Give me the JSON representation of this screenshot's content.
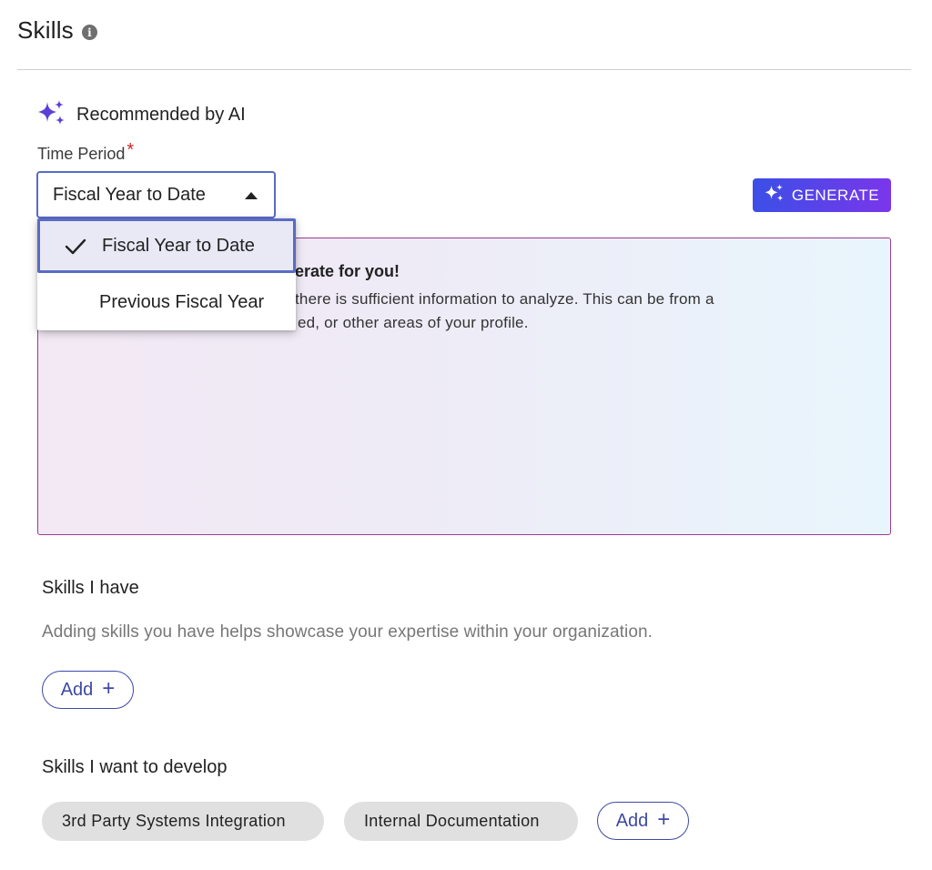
{
  "section": {
    "title": "Skills",
    "info_icon": "info-icon"
  },
  "ai": {
    "label": "Recommended by AI",
    "icon": "sparkles-icon",
    "accent": "#5b3fd6"
  },
  "time_period": {
    "label": "Time Period",
    "required_mark": "*",
    "selected": "Fiscal Year to Date",
    "options": [
      {
        "label": "Fiscal Year to Date",
        "selected": true
      },
      {
        "label": "Previous Fiscal Year",
        "selected": false
      }
    ]
  },
  "generate": {
    "label": "GENERATE",
    "gradient": [
      "#3b4fe6",
      "#7a36ea"
    ]
  },
  "panel": {
    "heading_visible": "erate for you!",
    "line1_visible": "there is sufficient information to analyze. This can be from a",
    "line2_visible": "ed, or other areas of your profile."
  },
  "skills_have": {
    "title": "Skills I have",
    "helper": "Adding skills you have helps showcase your expertise within your organization.",
    "add_label": "Add",
    "add_plus": "+"
  },
  "skills_develop": {
    "title": "Skills I want to develop",
    "chips": [
      "3rd Party Systems Integration",
      "Internal Documentation"
    ],
    "add_label": "Add",
    "add_plus": "+"
  },
  "colors": {
    "primary": "#3d4aa3",
    "focus_border": "#5a6bc4",
    "required": "#c62828",
    "panel_border": "#9b3a93"
  }
}
